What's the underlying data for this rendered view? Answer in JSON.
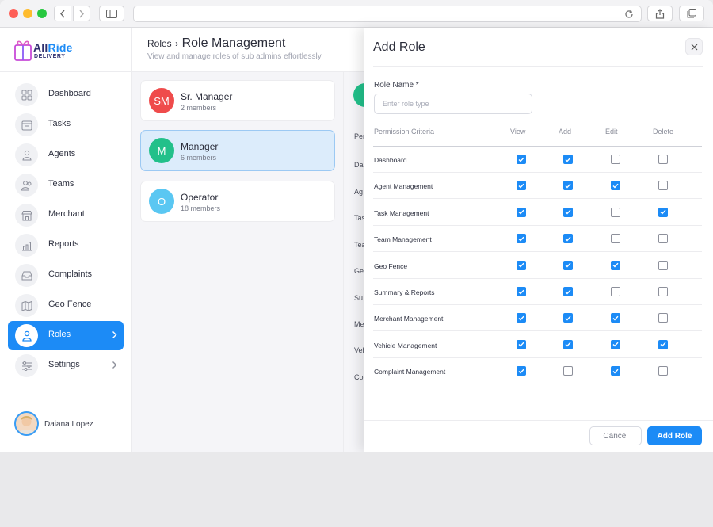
{
  "brand": {
    "name_part1": "All",
    "name_part2": "Ride",
    "subtitle": "DELIVERY"
  },
  "sidebar": {
    "items": [
      {
        "label": "Dashboard",
        "icon": "grid-icon"
      },
      {
        "label": "Tasks",
        "icon": "calendar-icon"
      },
      {
        "label": "Agents",
        "icon": "person-icon"
      },
      {
        "label": "Teams",
        "icon": "team-icon"
      },
      {
        "label": "Merchant",
        "icon": "store-icon"
      },
      {
        "label": "Reports",
        "icon": "chart-icon"
      },
      {
        "label": "Complaints",
        "icon": "inbox-icon"
      },
      {
        "label": "Geo Fence",
        "icon": "map-icon"
      },
      {
        "label": "Roles",
        "icon": "roles-icon",
        "active": true
      },
      {
        "label": "Settings",
        "icon": "sliders-icon"
      }
    ],
    "user": {
      "name": "Daiana Lopez"
    }
  },
  "header": {
    "breadcrumb_parent": "Roles",
    "breadcrumb_sep": "›",
    "title": "Role Management",
    "subtitle": "View and manage roles of sub admins effortlessly"
  },
  "roles": [
    {
      "initials": "SM",
      "name": "Sr. Manager",
      "members": "2 members",
      "color": "#ef4b4b"
    },
    {
      "initials": "M",
      "name": "Manager",
      "members": "6 members",
      "color": "#22c08a"
    },
    {
      "initials": "O",
      "name": "Operator",
      "members": "18 members",
      "color": "#5ac7f2"
    }
  ],
  "peek_labels": [
    "Per",
    "Da",
    "Ag",
    "Tas",
    "Tea",
    "Ge",
    "Su",
    "Me",
    "Veh",
    "Co"
  ],
  "panel": {
    "title": "Add Role",
    "role_name_label": "Role Name *",
    "role_name_placeholder": "Enter role type",
    "columns": [
      "Permission Criteria",
      "View",
      "Add",
      "Edit",
      "Delete"
    ],
    "rows": [
      {
        "label": "Dashboard",
        "view": true,
        "add": true,
        "edit": false,
        "delete": false
      },
      {
        "label": "Agent Management",
        "view": true,
        "add": true,
        "edit": true,
        "delete": false
      },
      {
        "label": "Task Management",
        "view": true,
        "add": true,
        "edit": false,
        "delete": true
      },
      {
        "label": "Team Management",
        "view": true,
        "add": true,
        "edit": false,
        "delete": false
      },
      {
        "label": "Geo Fence",
        "view": true,
        "add": true,
        "edit": true,
        "delete": false
      },
      {
        "label": "Summary & Reports",
        "view": true,
        "add": true,
        "edit": false,
        "delete": false
      },
      {
        "label": "Merchant Management",
        "view": true,
        "add": true,
        "edit": true,
        "delete": false
      },
      {
        "label": "Vehicle Management",
        "view": true,
        "add": true,
        "edit": true,
        "delete": true
      },
      {
        "label": "Complaint Management",
        "view": true,
        "add": false,
        "edit": true,
        "delete": false
      }
    ],
    "cancel_label": "Cancel",
    "submit_label": "Add Role"
  },
  "colors": {
    "accent": "#1c8bf6",
    "brand_dark": "#2e2e6e"
  }
}
